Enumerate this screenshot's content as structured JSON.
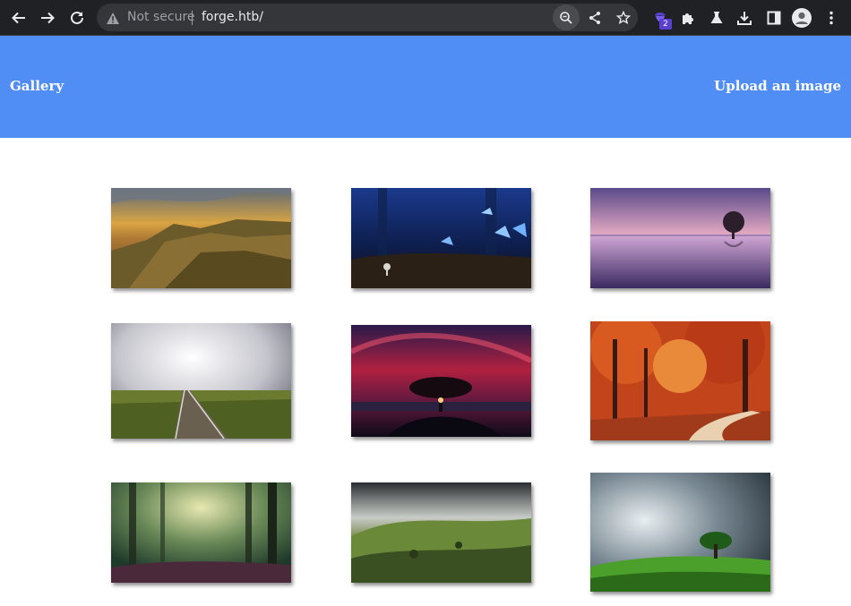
{
  "browser": {
    "security_text": "Not secure",
    "url": "forge.htb/",
    "extension_badge_count": "2",
    "icons": [
      "back-arrow-icon",
      "forward-arrow-icon",
      "reload-icon",
      "warning-icon",
      "zoom-icon",
      "share-icon",
      "star-icon",
      "extension-icon",
      "puzzle-icon",
      "labs-flask-icon",
      "download-icon",
      "side-panel-icon",
      "profile-avatar-icon",
      "kebab-menu-icon"
    ]
  },
  "site": {
    "nav": {
      "gallery_label": "Gallery",
      "upload_label": "Upload an image"
    },
    "brand_color": "#508ef5"
  },
  "gallery": {
    "images": [
      {
        "subject": "cliffs at sunset"
      },
      {
        "subject": "blue butterflies and mushrooms in forest"
      },
      {
        "subject": "lone tree in purple lake"
      },
      {
        "subject": "railway track under cloudy sky"
      },
      {
        "subject": "tree silhouette under red sky"
      },
      {
        "subject": "autumn forest path"
      },
      {
        "subject": "misty green forest"
      },
      {
        "subject": "green hills with clouds"
      },
      {
        "subject": "lone tree on green hill under storm clouds"
      }
    ]
  }
}
